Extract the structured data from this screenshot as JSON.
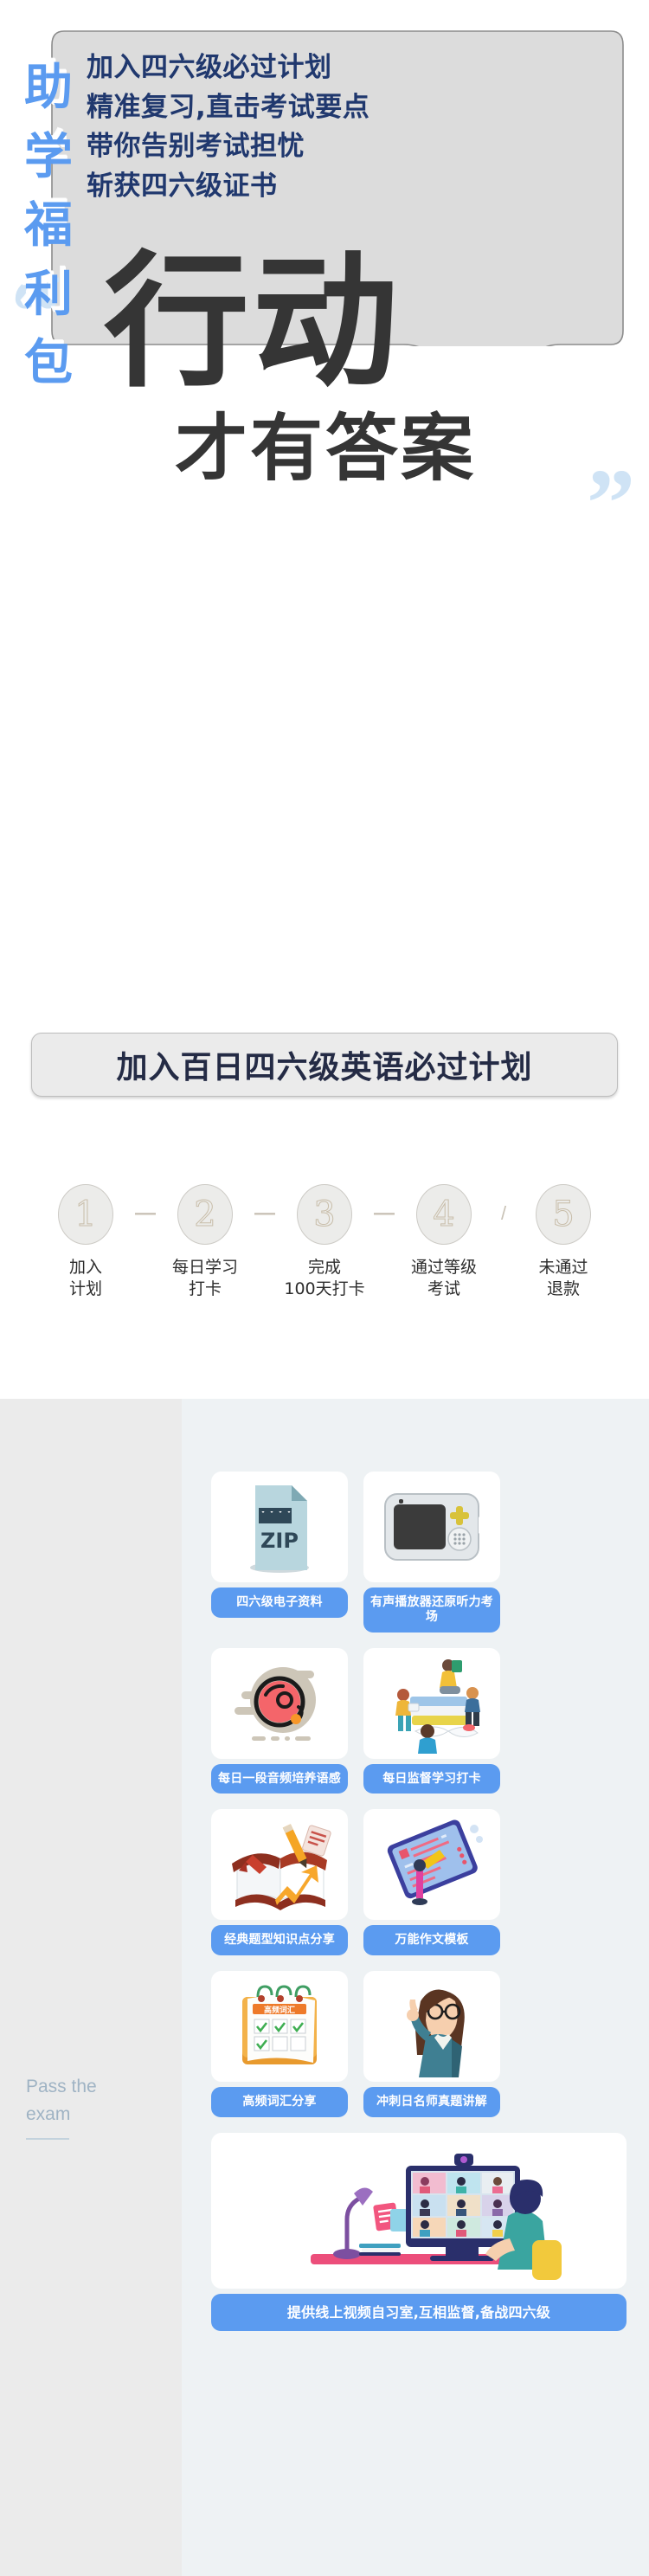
{
  "bubble": {
    "text": "加入四六级必过计划\n精准复习,直击考试要点\n带你告别考试担忧\n斩获四六级证书"
  },
  "headline": {
    "quote_open": "“",
    "line1": "行动",
    "line2": "才有答案",
    "quote_close": "”",
    "color": "#353535",
    "quote_color": "#cfe3f5"
  },
  "cta": {
    "label": "加入百日四六级英语必过计划",
    "bg": "#ebebeb",
    "text_color": "#242b45"
  },
  "steps": {
    "items": [
      {
        "num": "1",
        "label": "加入\n计划"
      },
      {
        "num": "2",
        "label": "每日学习\n打卡"
      },
      {
        "num": "3",
        "label": "完成\n100天打卡"
      },
      {
        "num": "4",
        "label": "通过等级\n考试"
      },
      {
        "num": "5",
        "label": "未通过\n退款"
      }
    ],
    "connectors": [
      "—",
      "—",
      "—",
      "/"
    ]
  },
  "benefits": {
    "vertical_title": [
      "助",
      "学",
      "福",
      "利",
      "包"
    ],
    "vertical_title_color": "#5b9bf0",
    "english_caption": "Pass the\nexam",
    "cards": [
      {
        "label": "四六级电子资料",
        "icon": "zip-file-icon"
      },
      {
        "label": "有声播放器还原听力考场",
        "icon": "audio-player-icon"
      },
      {
        "label": "每日一段音频培养语感",
        "icon": "vinyl-record-icon"
      },
      {
        "label": "每日监督学习打卡",
        "icon": "students-books-icon"
      },
      {
        "label": "经典题型知识点分享",
        "icon": "open-book-pencil-icon"
      },
      {
        "label": "万能作文模板",
        "icon": "tablet-writing-icon"
      },
      {
        "label": "高频词汇分享",
        "icon": "calendar-checklist-icon"
      },
      {
        "label": "冲刺日名师真题讲解",
        "icon": "teacher-pointing-icon"
      },
      {
        "label": "提供线上视频自习室,互相监督,备战四六级",
        "icon": "video-study-room-icon",
        "wide": true
      }
    ],
    "label_bg": "#5b9bf0",
    "panel_bg": "#eef2f4",
    "section_bg": "#ebebeb"
  }
}
